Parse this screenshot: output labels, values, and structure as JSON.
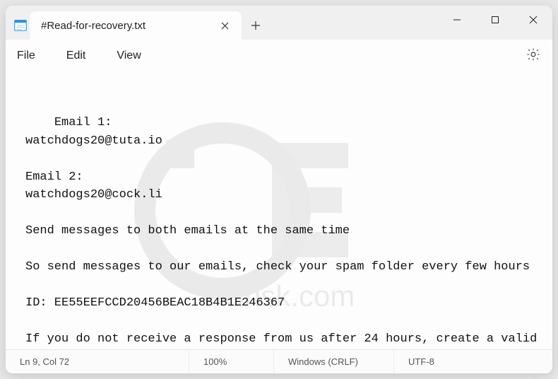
{
  "tab": {
    "title": "#Read-for-recovery.txt"
  },
  "menu": {
    "file": "File",
    "edit": "Edit",
    "view": "View"
  },
  "content": "Email 1:\nwatchdogs20@tuta.io\n\nEmail 2:\nwatchdogs20@cock.li\n\nSend messages to both emails at the same time\n\nSo send messages to our emails, check your spam folder every few hours \n\nID: EE55EEFCCD20456BEAC18B4B1E246367\n\nIf you do not receive a response from us after 24 hours, create a valid\nemail, for example, gmail,outlook\nThen send us a message with a new email",
  "status": {
    "pos": "Ln 9, Col 72",
    "zoom": "100%",
    "encoding": "Windows (CRLF)",
    "charset": "UTF-8"
  },
  "watermark": "PCrisk.com"
}
